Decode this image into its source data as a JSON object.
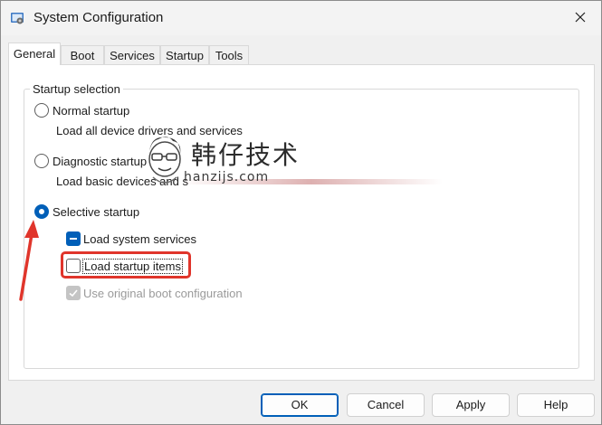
{
  "window": {
    "title": "System Configuration"
  },
  "tabs": [
    {
      "label": "General",
      "active": true
    },
    {
      "label": "Boot",
      "active": false
    },
    {
      "label": "Services",
      "active": false
    },
    {
      "label": "Startup",
      "active": false
    },
    {
      "label": "Tools",
      "active": false
    }
  ],
  "startup_selection": {
    "group_label": "Startup selection",
    "normal": {
      "label": "Normal startup",
      "description": "Load all device drivers and services",
      "selected": false
    },
    "diagnostic": {
      "label": "Diagnostic startup",
      "description": "Load basic devices and s",
      "selected": false
    },
    "selective": {
      "label": "Selective startup",
      "selected": true,
      "options": [
        {
          "label": "Load system services",
          "state": "indeterminate"
        },
        {
          "label": "Load startup items",
          "state": "unchecked"
        },
        {
          "label": "Use original boot configuration",
          "state": "checked-disabled"
        }
      ]
    }
  },
  "watermark": {
    "cn_text": "韩仔技术",
    "url_text": "hanzijs.com"
  },
  "buttons": {
    "ok": "OK",
    "cancel": "Cancel",
    "apply": "Apply",
    "help": "Help"
  },
  "colors": {
    "accent": "#005fb8",
    "annotation": "#e0352b"
  },
  "icons": [
    "msconfig-app-icon",
    "close-icon",
    "annotation-arrow",
    "watermark-mascot-icon"
  ]
}
